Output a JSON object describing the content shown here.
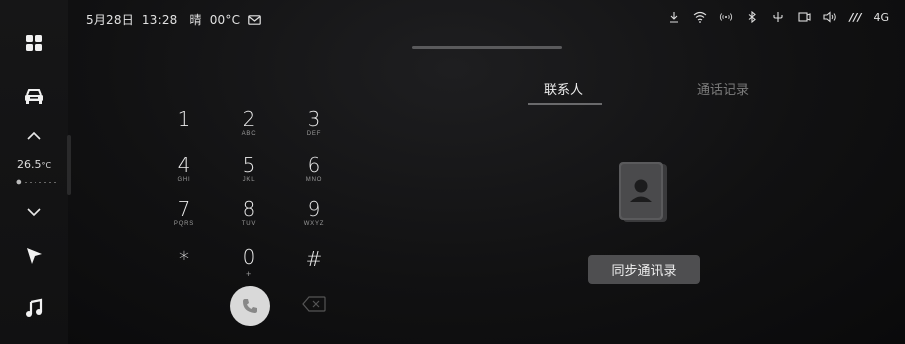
{
  "status_bar": {
    "date": "5月28日",
    "time": "13:28",
    "weather": "晴",
    "temperature": "00°C",
    "network": "4G",
    "signal_bars": "///",
    "icons": [
      "download-icon",
      "wifi-icon",
      "hotspot-icon",
      "bluetooth-icon",
      "usb-icon",
      "screen-mirror-icon",
      "volume-icon"
    ]
  },
  "left_rail": {
    "icons": [
      "apps-grid-icon",
      "car-icon",
      "chevron-up-icon",
      "chevron-down-icon",
      "navigation-arrow-icon",
      "music-note-icon"
    ],
    "temperature_value": "26.5",
    "temperature_unit": "°C"
  },
  "dialpad": {
    "keys": [
      {
        "num": "1",
        "letters": ""
      },
      {
        "num": "2",
        "letters": "ABC"
      },
      {
        "num": "3",
        "letters": "DEF"
      },
      {
        "num": "4",
        "letters": "GHI"
      },
      {
        "num": "5",
        "letters": "JKL"
      },
      {
        "num": "6",
        "letters": "MNO"
      },
      {
        "num": "7",
        "letters": "PQRS"
      },
      {
        "num": "8",
        "letters": "TUV"
      },
      {
        "num": "9",
        "letters": "WXYZ"
      },
      {
        "num": "*",
        "letters": ""
      },
      {
        "num": "0",
        "letters": "+"
      },
      {
        "num": "#",
        "letters": ""
      }
    ]
  },
  "tabs": {
    "contacts": "联系人",
    "call_log": "通话记录",
    "active": "contacts"
  },
  "contacts_panel": {
    "sync_button_label": "同步通讯录"
  },
  "colors": {
    "background": "#111112",
    "call_button": "#d9d9d9",
    "sync_button": "#4e4e50",
    "active_tab": "#ededed",
    "inactive_tab": "#7c7c7c"
  }
}
